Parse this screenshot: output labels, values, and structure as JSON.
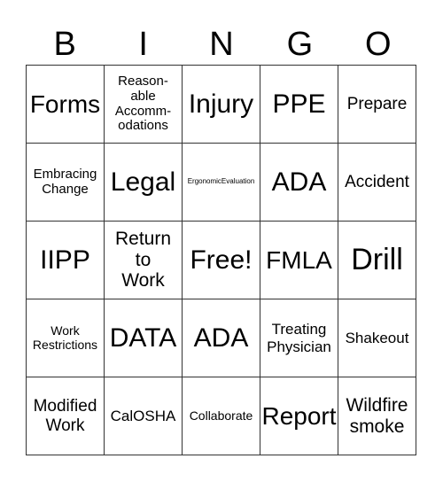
{
  "header": {
    "letters": [
      "B",
      "I",
      "N",
      "G",
      "O"
    ]
  },
  "rows": [
    [
      "Forms",
      "Reason-\nable\nAccomm-\nodations",
      "Injury",
      "PPE",
      "Prepare"
    ],
    [
      "Embracing\nChange",
      "Legal",
      "ErgonomicEvaluation",
      "ADA",
      "Accident"
    ],
    [
      "IIPP",
      "Return\nto\nWork",
      "Free!",
      "FMLA",
      "Drill"
    ],
    [
      "Work\nRestrictions",
      "DATA",
      "ADA",
      "Treating\nPhysician",
      "Shakeout"
    ],
    [
      "Modified\nWork",
      "CalOSHA",
      "Collaborate",
      "Report",
      "Wildfire\nsmoke"
    ]
  ]
}
